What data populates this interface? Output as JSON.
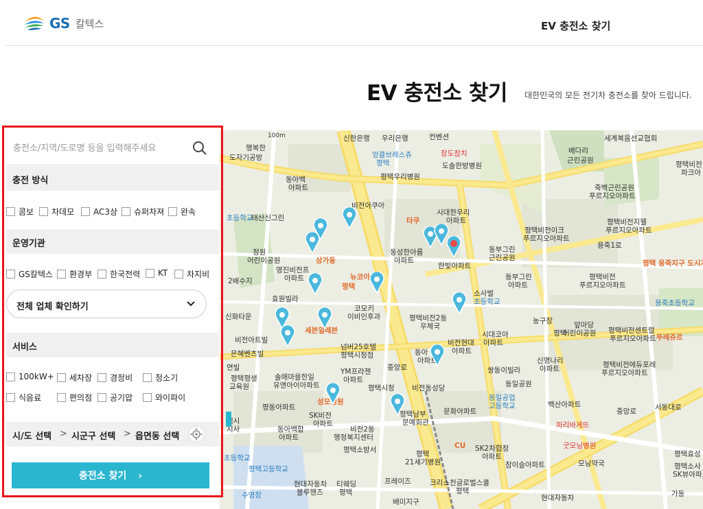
{
  "header": {
    "logo_text": "GS",
    "logo_sub": "칼텍스",
    "nav_title": "EV 충전소 찾기"
  },
  "page": {
    "title": "EV 충전소 찾기",
    "subtitle": "대한민국의 모든 전기차 충전소를 찾아 드립니다."
  },
  "search": {
    "placeholder": "충전소/지역/도로명 등을 입력해주세요"
  },
  "sections": {
    "charge_method": {
      "title": "충전 방식",
      "options": [
        "콤보",
        "차데모",
        "AC3상",
        "슈퍼차져",
        "완속"
      ]
    },
    "operator": {
      "title": "운영기관",
      "options": [
        "GS칼텍스",
        "환경부",
        "한국전력",
        "KT",
        "차지비"
      ],
      "dropdown_label": "전체 업체 확인하기"
    },
    "service": {
      "title": "서비스",
      "options_row1": [
        "100kW+",
        "세차장",
        "경정비",
        "청소기"
      ],
      "options_row2": [
        "식음료",
        "편의점",
        "공기압",
        "와이파이"
      ]
    }
  },
  "region": {
    "sido": "시/도 선택",
    "sigungu": "시군구 선택",
    "eupmyeondong": "읍면동 선택",
    "separator": ">"
  },
  "find_button": {
    "label": "충전소 찾기"
  },
  "map": {
    "scale": "100m",
    "labels": [
      "신한은행",
      "우리은행",
      "컨벤션",
      "세계복음선교협회",
      "배다리",
      "근린공원",
      "행복한",
      "도자기공방",
      "엉클브레스츄",
      "평택",
      "장도참치",
      "도솔한방병원",
      "평택비전",
      "파크아",
      "동아백",
      "아파트",
      "평택우리병원",
      "죽백근린공원",
      "푸르지오아파트",
      "비전아쿠아",
      "시대한우리",
      "아파트",
      "태산신그린",
      "초등학교",
      "타쿠",
      "평택비전이크",
      "평택비전지웰",
      "푸르지오아파트",
      "푸르지오아파트",
      "정원",
      "어린이공원",
      "상가동",
      "동성한아름",
      "아파트",
      "동부그린",
      "근린공원",
      "한빛아파트",
      "용죽1로",
      "평택 용죽지구 도시개발",
      "영진비전프",
      "아파트",
      "뉴코아",
      "평택",
      "동부그린",
      "아파트",
      "평택비전",
      "푸르지오아파트",
      "2배수지",
      "효원빌라",
      "코모키",
      "이비인후과",
      "소사벌",
      "초등학교",
      "용죽초등학교",
      "신화타운",
      "세븐일레븐",
      "평택비전2동",
      "우체국",
      "농구장",
      "앞마당",
      "어린이공원",
      "평택비전센트럴",
      "푸르지오아파트",
      "뚜레쥬르",
      "비전아트빌",
      "넘버25호텔",
      "평택시청점",
      "시대코아",
      "아파트",
      "평택",
      "은혜벤츠빌",
      "동아",
      "아파트",
      "비전현대",
      "아파트",
      "신명나리",
      "아파트",
      "평택비전에듀포레",
      "푸르지오아파트",
      "면빌",
      "솔매마을한일",
      "유앤아이아파트",
      "YM프라젠",
      "아파트",
      "중앙로",
      "쌍동이빌라",
      "동일공원",
      "평택평생",
      "교육원",
      "비전동성당",
      "동일공업",
      "고등학교",
      "백산아파트",
      "성모병원",
      "평택시청",
      "평동아파트",
      "SK비전",
      "아파트",
      "평택남부",
      "문예회관",
      "문화아파트",
      "중앙로",
      "서동대로",
      "택시",
      "지사",
      "동아백합",
      "아파트",
      "비전2동",
      "행정복지센터",
      "파리바게뜨",
      "초등학교",
      "평택고등학교",
      "평택소방서",
      "CU",
      "SK2차합정",
      "아파트",
      "굿모닝병원",
      "평택효성",
      "평택",
      "21세기병원",
      "참이슬아파트",
      "모닝약국",
      "평택소사",
      "SK뷰아파트",
      "수영장",
      "현대자동차",
      "블루핸즈",
      "티웨딩",
      "평택",
      "프레이즈",
      "크리스천글로벌스쿨",
      "평택",
      "현대자동차",
      "가동",
      "배미지구"
    ]
  },
  "colors": {
    "accent": "#2bb6cf",
    "highlight_border": "#e8131b",
    "brand_blue": "#1d6fb3"
  }
}
